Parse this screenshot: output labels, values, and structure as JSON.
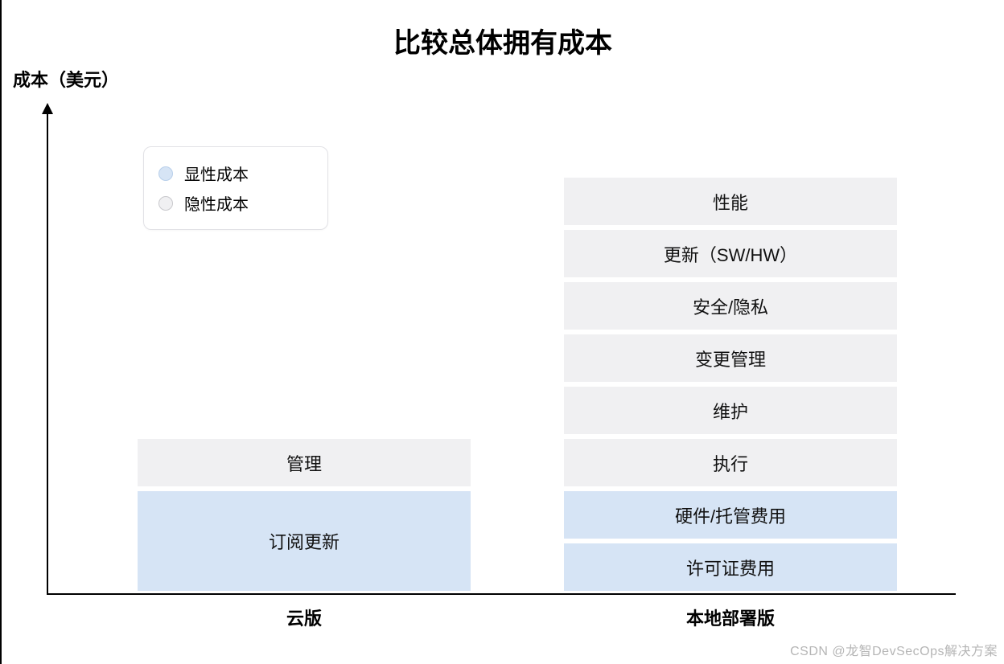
{
  "title": "比较总体拥有成本",
  "yaxis_label": "成本（美元）",
  "legend": {
    "explicit": "显性成本",
    "hidden": "隐性成本"
  },
  "categories": {
    "cloud": "云版",
    "onprem": "本地部署版"
  },
  "watermark": "CSDN @龙智DevSecOps解决方案",
  "chart_data": {
    "type": "bar",
    "title": "比较总体拥有成本",
    "ylabel": "成本（美元）",
    "xlabel": "",
    "ylim": [
      0,
      8
    ],
    "categories": [
      "云版",
      "本地部署版"
    ],
    "series": [
      {
        "name": "显性成本",
        "stacks": {
          "云版": [
            {
              "label": "订阅更新",
              "value": 2
            }
          ],
          "本地部署版": [
            {
              "label": "许可证费用",
              "value": 1
            },
            {
              "label": "硬件/托管费用",
              "value": 1
            }
          ]
        }
      },
      {
        "name": "隐性成本",
        "stacks": {
          "云版": [
            {
              "label": "管理",
              "value": 1
            }
          ],
          "本地部署版": [
            {
              "label": "执行",
              "value": 1
            },
            {
              "label": "维护",
              "value": 1
            },
            {
              "label": "变更管理",
              "value": 1
            },
            {
              "label": "安全/隐私",
              "value": 1
            },
            {
              "label": "更新（SW/HW）",
              "value": 1
            },
            {
              "label": "性能",
              "value": 1
            }
          ]
        }
      }
    ],
    "colors": {
      "显性成本": "#d6e4f5",
      "隐性成本": "#f0f0f2"
    }
  }
}
